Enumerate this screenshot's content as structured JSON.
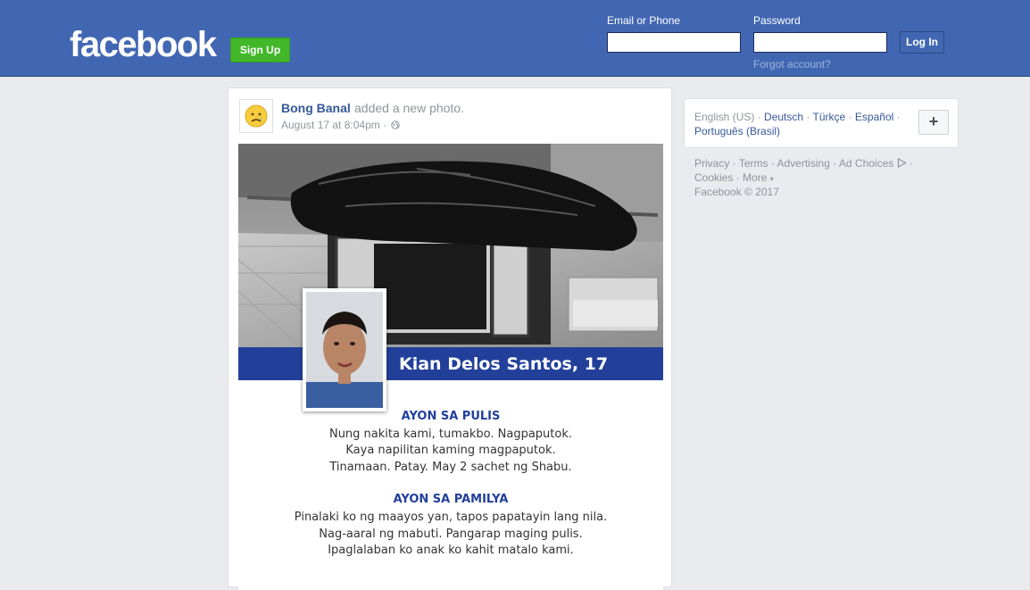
{
  "header": {
    "logo": "facebook",
    "signup_label": "Sign Up",
    "email_label": "Email or Phone",
    "password_label": "Password",
    "email_value": "",
    "password_value": "",
    "login_label": "Log In",
    "forgot_label": "Forgot account?",
    "brand_color": "#4267b2"
  },
  "post": {
    "author": "Bong Banal",
    "action": "added a new photo.",
    "date": "August 17 at 8:04pm",
    "separator": "·",
    "privacy_icon": "globe-icon",
    "avatar_icon": "sad-face-icon",
    "photo": {
      "name_caption": "Kian Delos Santos, 17",
      "band_color": "#22409a",
      "police_title": "AYON SA PULIS",
      "police_lines": [
        "Nung nakita kami, tumakbo. Nagpaputok.",
        "Kaya napilitan kaming magpaputok.",
        "Tinamaan. Patay. May 2 sachet ng Shabu."
      ],
      "family_title": "AYON SA PAMILYA",
      "family_lines": [
        "Pinalaki ko ng maayos yan, tapos papatayin lang nila.",
        "Nag-aaral ng mabuti. Pangarap maging pulis.",
        "Ipaglalaban ko anak ko kahit matalo kami."
      ]
    }
  },
  "languages": {
    "current": "English (US)",
    "options": [
      "Deutsch",
      "Türkçe",
      "Español",
      "Português (Brasil)"
    ],
    "separator": "·",
    "more_button": "+"
  },
  "footer": {
    "privacy": "Privacy",
    "terms": "Terms",
    "advertising": "Advertising",
    "ad_choices": "Ad Choices",
    "cookies": "Cookies",
    "more": "More",
    "copyright": "Facebook © 2017",
    "separator": "·"
  }
}
